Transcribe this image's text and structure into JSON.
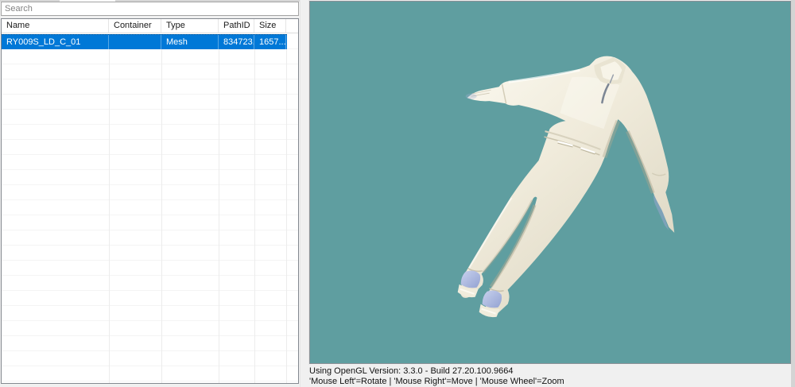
{
  "window": {
    "background": "#f0f0f0"
  },
  "left_panel": {
    "search": {
      "placeholder": "Search",
      "value": ""
    },
    "table": {
      "columns": [
        {
          "label": "Name",
          "width": 135
        },
        {
          "label": "Container",
          "width": 66
        },
        {
          "label": "Type",
          "width": 72
        },
        {
          "label": "PathID",
          "width": 45
        },
        {
          "label": "Size",
          "width": 40
        }
      ],
      "rows": [
        {
          "name": "RY009S_LD_C_01",
          "container": "",
          "type": "Mesh",
          "path_id": "834723...",
          "size": "1657...",
          "selected": true
        }
      ],
      "selection_color": "#0078d7"
    }
  },
  "preview": {
    "background_color": "#5f9ea0",
    "model_color": "#efead8",
    "shoe_accent_color": "#9aa8d6"
  },
  "status_bar": {
    "line1": "Using OpenGL Version: 3.3.0 - Build 27.20.100.9664",
    "line2": "'Mouse Left'=Rotate | 'Mouse Right'=Move | 'Mouse Wheel'=Zoom"
  }
}
